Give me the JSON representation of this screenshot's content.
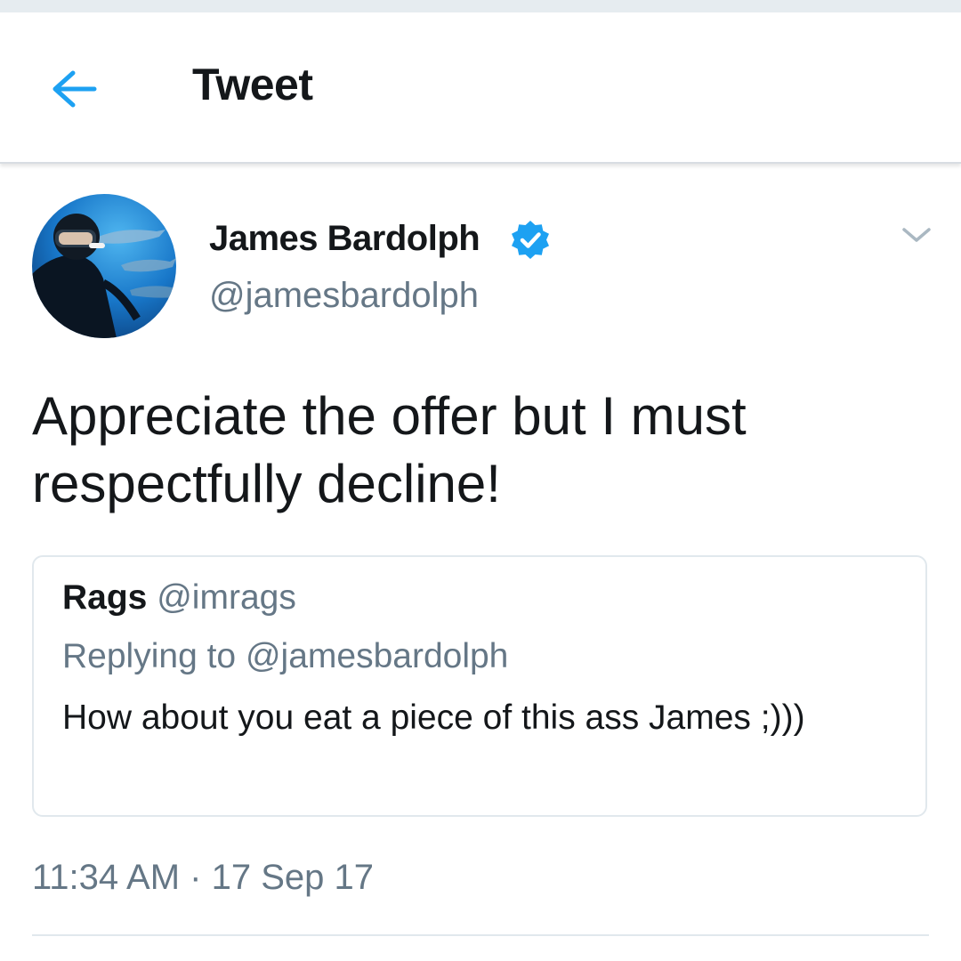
{
  "header": {
    "title": "Tweet",
    "back_icon": "arrow-left-icon",
    "accent_color": "#1da1f2"
  },
  "tweet": {
    "author": {
      "name": "James Bardolph",
      "handle": "@jamesbardolph",
      "verified": true,
      "avatar": "scuba-diver-with-sharks-avatar"
    },
    "menu_icon": "chevron-down-icon",
    "text": "Appreciate the offer but I must respectfully decline!",
    "timestamp": "11:34 AM · 17 Sep 17"
  },
  "quoted_tweet": {
    "name": "Rags",
    "handle": "@imrags",
    "replying_to": "Replying to @jamesbardolph",
    "text": "How about you eat a piece of this ass James ;)))"
  },
  "colors": {
    "primary_text": "#14171a",
    "secondary_text": "#657786",
    "border": "#e1e8ed",
    "verified_badge": "#1da1f2"
  }
}
